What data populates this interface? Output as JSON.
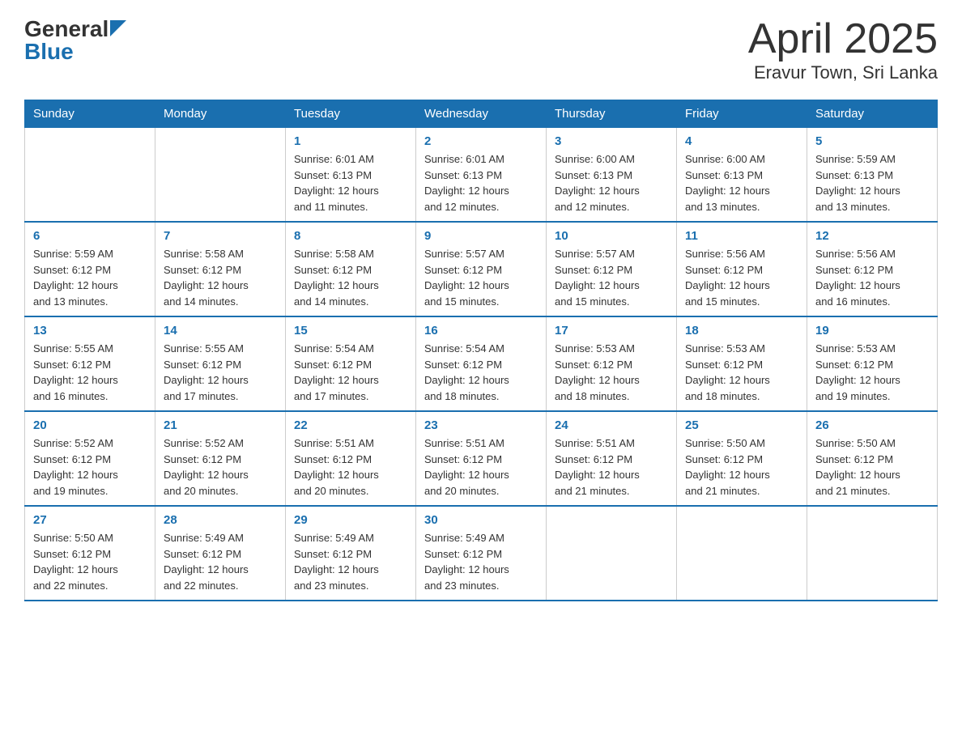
{
  "header": {
    "logo_general": "General",
    "logo_blue": "Blue",
    "title": "April 2025",
    "subtitle": "Eravur Town, Sri Lanka"
  },
  "days_of_week": [
    "Sunday",
    "Monday",
    "Tuesday",
    "Wednesday",
    "Thursday",
    "Friday",
    "Saturday"
  ],
  "weeks": [
    [
      {
        "day": "",
        "info": ""
      },
      {
        "day": "",
        "info": ""
      },
      {
        "day": "1",
        "info": "Sunrise: 6:01 AM\nSunset: 6:13 PM\nDaylight: 12 hours\nand 11 minutes."
      },
      {
        "day": "2",
        "info": "Sunrise: 6:01 AM\nSunset: 6:13 PM\nDaylight: 12 hours\nand 12 minutes."
      },
      {
        "day": "3",
        "info": "Sunrise: 6:00 AM\nSunset: 6:13 PM\nDaylight: 12 hours\nand 12 minutes."
      },
      {
        "day": "4",
        "info": "Sunrise: 6:00 AM\nSunset: 6:13 PM\nDaylight: 12 hours\nand 13 minutes."
      },
      {
        "day": "5",
        "info": "Sunrise: 5:59 AM\nSunset: 6:13 PM\nDaylight: 12 hours\nand 13 minutes."
      }
    ],
    [
      {
        "day": "6",
        "info": "Sunrise: 5:59 AM\nSunset: 6:12 PM\nDaylight: 12 hours\nand 13 minutes."
      },
      {
        "day": "7",
        "info": "Sunrise: 5:58 AM\nSunset: 6:12 PM\nDaylight: 12 hours\nand 14 minutes."
      },
      {
        "day": "8",
        "info": "Sunrise: 5:58 AM\nSunset: 6:12 PM\nDaylight: 12 hours\nand 14 minutes."
      },
      {
        "day": "9",
        "info": "Sunrise: 5:57 AM\nSunset: 6:12 PM\nDaylight: 12 hours\nand 15 minutes."
      },
      {
        "day": "10",
        "info": "Sunrise: 5:57 AM\nSunset: 6:12 PM\nDaylight: 12 hours\nand 15 minutes."
      },
      {
        "day": "11",
        "info": "Sunrise: 5:56 AM\nSunset: 6:12 PM\nDaylight: 12 hours\nand 15 minutes."
      },
      {
        "day": "12",
        "info": "Sunrise: 5:56 AM\nSunset: 6:12 PM\nDaylight: 12 hours\nand 16 minutes."
      }
    ],
    [
      {
        "day": "13",
        "info": "Sunrise: 5:55 AM\nSunset: 6:12 PM\nDaylight: 12 hours\nand 16 minutes."
      },
      {
        "day": "14",
        "info": "Sunrise: 5:55 AM\nSunset: 6:12 PM\nDaylight: 12 hours\nand 17 minutes."
      },
      {
        "day": "15",
        "info": "Sunrise: 5:54 AM\nSunset: 6:12 PM\nDaylight: 12 hours\nand 17 minutes."
      },
      {
        "day": "16",
        "info": "Sunrise: 5:54 AM\nSunset: 6:12 PM\nDaylight: 12 hours\nand 18 minutes."
      },
      {
        "day": "17",
        "info": "Sunrise: 5:53 AM\nSunset: 6:12 PM\nDaylight: 12 hours\nand 18 minutes."
      },
      {
        "day": "18",
        "info": "Sunrise: 5:53 AM\nSunset: 6:12 PM\nDaylight: 12 hours\nand 18 minutes."
      },
      {
        "day": "19",
        "info": "Sunrise: 5:53 AM\nSunset: 6:12 PM\nDaylight: 12 hours\nand 19 minutes."
      }
    ],
    [
      {
        "day": "20",
        "info": "Sunrise: 5:52 AM\nSunset: 6:12 PM\nDaylight: 12 hours\nand 19 minutes."
      },
      {
        "day": "21",
        "info": "Sunrise: 5:52 AM\nSunset: 6:12 PM\nDaylight: 12 hours\nand 20 minutes."
      },
      {
        "day": "22",
        "info": "Sunrise: 5:51 AM\nSunset: 6:12 PM\nDaylight: 12 hours\nand 20 minutes."
      },
      {
        "day": "23",
        "info": "Sunrise: 5:51 AM\nSunset: 6:12 PM\nDaylight: 12 hours\nand 20 minutes."
      },
      {
        "day": "24",
        "info": "Sunrise: 5:51 AM\nSunset: 6:12 PM\nDaylight: 12 hours\nand 21 minutes."
      },
      {
        "day": "25",
        "info": "Sunrise: 5:50 AM\nSunset: 6:12 PM\nDaylight: 12 hours\nand 21 minutes."
      },
      {
        "day": "26",
        "info": "Sunrise: 5:50 AM\nSunset: 6:12 PM\nDaylight: 12 hours\nand 21 minutes."
      }
    ],
    [
      {
        "day": "27",
        "info": "Sunrise: 5:50 AM\nSunset: 6:12 PM\nDaylight: 12 hours\nand 22 minutes."
      },
      {
        "day": "28",
        "info": "Sunrise: 5:49 AM\nSunset: 6:12 PM\nDaylight: 12 hours\nand 22 minutes."
      },
      {
        "day": "29",
        "info": "Sunrise: 5:49 AM\nSunset: 6:12 PM\nDaylight: 12 hours\nand 23 minutes."
      },
      {
        "day": "30",
        "info": "Sunrise: 5:49 AM\nSunset: 6:12 PM\nDaylight: 12 hours\nand 23 minutes."
      },
      {
        "day": "",
        "info": ""
      },
      {
        "day": "",
        "info": ""
      },
      {
        "day": "",
        "info": ""
      }
    ]
  ]
}
